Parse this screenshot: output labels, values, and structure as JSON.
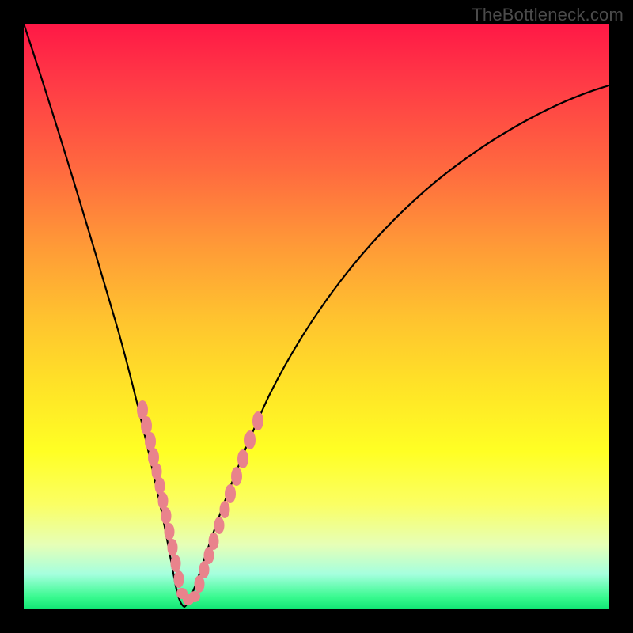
{
  "watermark": "TheBottleneck.com",
  "chart_data": {
    "type": "line",
    "title": "",
    "xlabel": "",
    "ylabel": "",
    "xlim": [
      0,
      100
    ],
    "ylim": [
      0,
      100
    ],
    "series": [
      {
        "name": "curve",
        "x": [
          0,
          3,
          6,
          9,
          12,
          14,
          16,
          18,
          20,
          22,
          23.5,
          25,
          26.5,
          28,
          30,
          33,
          37,
          42,
          48,
          55,
          63,
          72,
          82,
          93,
          100
        ],
        "y": [
          100,
          90,
          80,
          70,
          60,
          52,
          44,
          36,
          28,
          18,
          10,
          2,
          2,
          8,
          18,
          30,
          42,
          52,
          60,
          67,
          73,
          78,
          82,
          85,
          87
        ]
      }
    ],
    "markers": {
      "name": "pink-beads",
      "points": [
        {
          "x": 18.0,
          "y": 35
        },
        {
          "x": 18.8,
          "y": 31
        },
        {
          "x": 19.6,
          "y": 27
        },
        {
          "x": 20.4,
          "y": 23
        },
        {
          "x": 21.0,
          "y": 20
        },
        {
          "x": 21.6,
          "y": 16
        },
        {
          "x": 22.2,
          "y": 13
        },
        {
          "x": 22.8,
          "y": 10
        },
        {
          "x": 23.3,
          "y": 7
        },
        {
          "x": 23.8,
          "y": 4.5
        },
        {
          "x": 24.3,
          "y": 2.7
        },
        {
          "x": 25.0,
          "y": 1.7
        },
        {
          "x": 25.7,
          "y": 1.7
        },
        {
          "x": 26.4,
          "y": 2.7
        },
        {
          "x": 27.0,
          "y": 4.5
        },
        {
          "x": 27.6,
          "y": 7
        },
        {
          "x": 28.2,
          "y": 10
        },
        {
          "x": 29.0,
          "y": 14
        },
        {
          "x": 29.8,
          "y": 18
        },
        {
          "x": 30.6,
          "y": 22
        },
        {
          "x": 31.6,
          "y": 26
        },
        {
          "x": 32.6,
          "y": 30
        },
        {
          "x": 33.8,
          "y": 34
        }
      ]
    },
    "background_gradient": {
      "top": "#ff1846",
      "mid": "#ffe327",
      "bottom": "#11e574"
    }
  }
}
